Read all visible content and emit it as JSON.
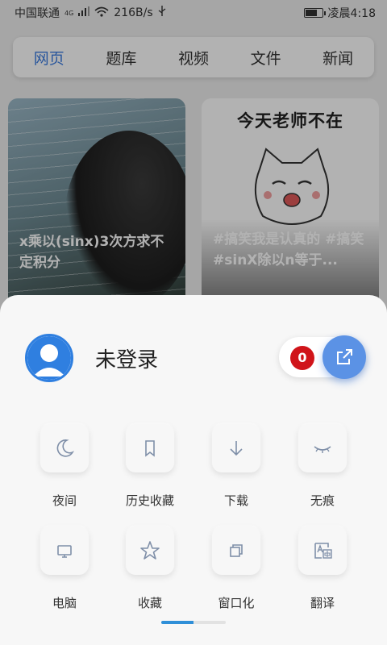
{
  "status_bar": {
    "carrier": "中国联通",
    "network_tag": "4G",
    "speed": "216B/s",
    "time": "凌晨4:18"
  },
  "tabs": [
    {
      "label": "网页",
      "active": true
    },
    {
      "label": "题库",
      "active": false
    },
    {
      "label": "视频",
      "active": false
    },
    {
      "label": "文件",
      "active": false
    },
    {
      "label": "新闻",
      "active": false
    }
  ],
  "cards": [
    {
      "title": "x乘以(sinx)3次方求不定积分"
    },
    {
      "image_text": "今天老师不在",
      "title": "#搞笑我是认真的 #搞笑 #sinX除以n等于..."
    }
  ],
  "sheet": {
    "login_label": "未登录",
    "badge_count": "0",
    "items": [
      {
        "label": "夜间",
        "icon": "moon-icon"
      },
      {
        "label": "历史收藏",
        "icon": "bookmark-icon"
      },
      {
        "label": "下载",
        "icon": "download-arrow-icon"
      },
      {
        "label": "无痕",
        "icon": "closed-eye-icon"
      },
      {
        "label": "电脑",
        "icon": "monitor-icon"
      },
      {
        "label": "收藏",
        "icon": "star-icon"
      },
      {
        "label": "窗口化",
        "icon": "window-icon"
      },
      {
        "label": "翻译",
        "icon": "translate-icon"
      }
    ]
  },
  "colors": {
    "accent": "#3b7be0",
    "badge": "#d0141a",
    "share_button": "#5b92e5"
  }
}
